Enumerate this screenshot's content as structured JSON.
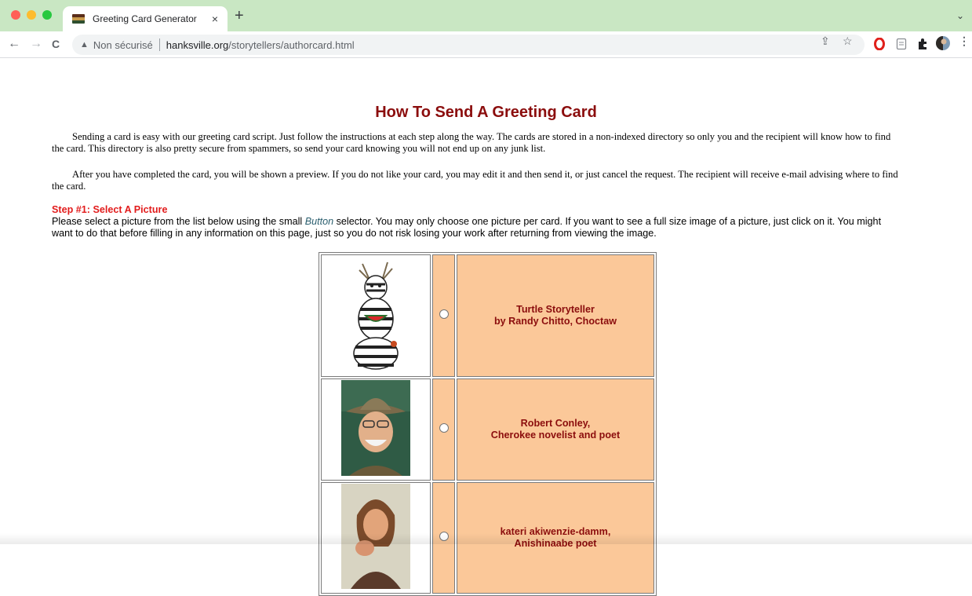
{
  "browser": {
    "tab_title": "Greeting Card Generator",
    "tab_close": "×",
    "new_tab": "+",
    "tab_menu": "⌄",
    "security_label": "Non sécurisé",
    "url_host": "hanksville.org",
    "url_path": "/storytellers/authorcard.html",
    "back": "←",
    "forward": "→",
    "reload": "C"
  },
  "page": {
    "heading": "How To Send A Greeting Card",
    "paragraph1": "Sending a card is easy with our greeting card script. Just follow the instructions at each step along the way. The cards are stored in a non-indexed directory so only you and the recipient will know how to find the card. This directory is also pretty secure from spammers, so send your card knowing you will not end up on any junk list.",
    "paragraph2": "After you have completed the card, you will be shown a preview. If you do not like your card, you may edit it and then send it, or just cancel the request. The recipient will receive e-mail advising where to find the card.",
    "step1_title": "Step #1: Select A Picture",
    "step1_text_before": "Please select a picture from the list below using the small ",
    "step1_button_word": "Button",
    "step1_text_after": " selector. You may only choose one picture per card. If you want to see a full size image of a picture, just click on it. You might want to do that before filling in any information on this page, just so you do not risk losing your work after returning from viewing the image."
  },
  "pictures": [
    {
      "line1": "Turtle Storyteller",
      "line2": "by Randy Chitto, Choctaw"
    },
    {
      "line1": "Robert Conley,",
      "line2": "Cherokee novelist and poet"
    },
    {
      "line1": "kateri akiwenzie-damm,",
      "line2": "Anishinaabe poet"
    }
  ]
}
